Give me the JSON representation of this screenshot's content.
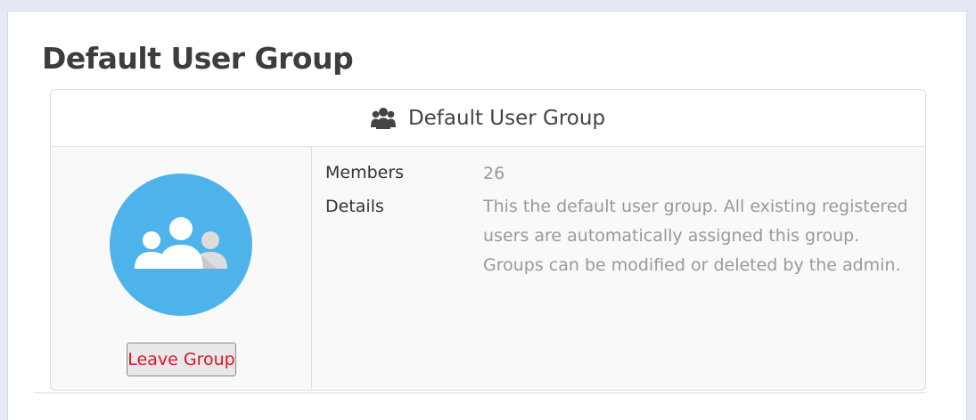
{
  "page": {
    "title": "Default User Group"
  },
  "card": {
    "header_title": "Default User Group",
    "header_icon": "users-icon",
    "avatar_icon": "user-group-icon",
    "avatar_color": "#4db3ea",
    "fields": {
      "members_label": "Members",
      "members_value": "26",
      "details_label": "Details",
      "details_value": "This the default user group. All existing registered users are automatically assigned this group. Groups can be modified or deleted by the admin."
    },
    "leave_button_label": "Leave Group",
    "leave_button_color": "#e0141e"
  }
}
